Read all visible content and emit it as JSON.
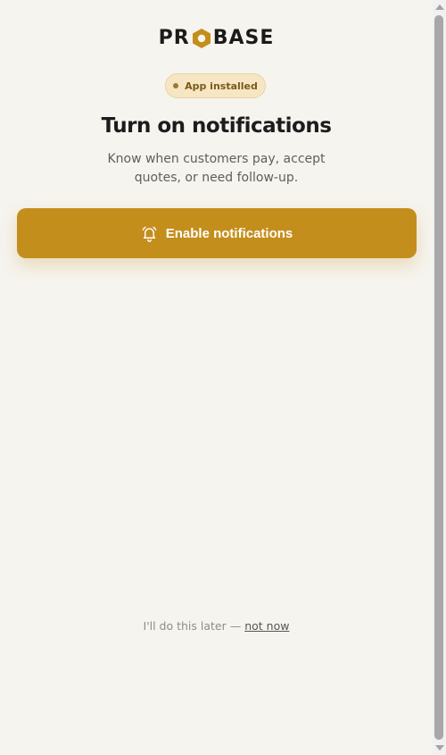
{
  "brand": {
    "logo_left": "PR",
    "logo_right": "BASE",
    "accent_color": "#c48e1c"
  },
  "badge": {
    "label": "App installed"
  },
  "title": "Turn on notifications",
  "subtitle": "Know when customers pay, accept quotes, or need follow-up.",
  "enable_button": {
    "icon": "bell-icon",
    "label": "Enable notifications"
  },
  "later": {
    "prefix": "I'll do this later — ",
    "link_label": "not now"
  }
}
